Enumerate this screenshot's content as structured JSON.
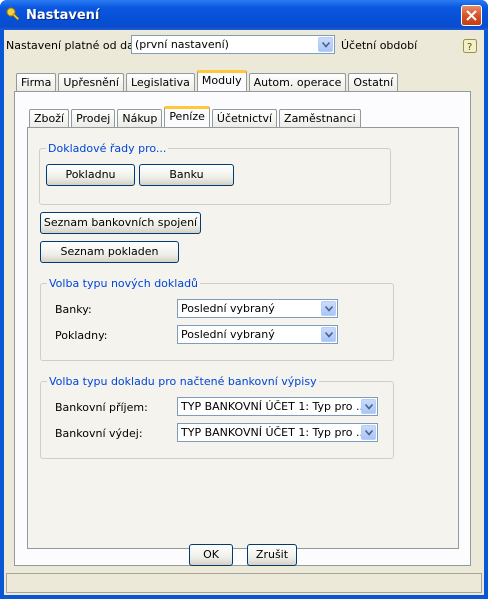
{
  "window": {
    "title": "Nastavení"
  },
  "top_row": {
    "label": "Nastavení platné od data:",
    "combo_value": "(první nastavení)",
    "period_label": "Účetní období"
  },
  "main_tabs": [
    {
      "label": "Firma",
      "active": false
    },
    {
      "label": "Upřesnění",
      "active": false
    },
    {
      "label": "Legislativa",
      "active": false
    },
    {
      "label": "Moduly",
      "active": true
    },
    {
      "label": "Autom. operace",
      "active": false
    },
    {
      "label": "Ostatní",
      "active": false
    }
  ],
  "sub_tabs": [
    {
      "label": "Zboží",
      "active": false
    },
    {
      "label": "Prodej",
      "active": false
    },
    {
      "label": "Nákup",
      "active": false
    },
    {
      "label": "Peníze",
      "active": true
    },
    {
      "label": "Účetnictví",
      "active": false
    },
    {
      "label": "Zaměstnanci",
      "active": false
    }
  ],
  "doc_series": {
    "title": "Dokladové řady pro...",
    "cash_button": "Pokladnu",
    "bank_button": "Banku"
  },
  "bank_list_button": "Seznam bankovních spojení",
  "cash_list_button": "Seznam pokladen",
  "new_doc_type": {
    "title": "Volba typu nových dokladů",
    "banks_label": "Banky:",
    "banks_value": "Poslední vybraný",
    "cash_label": "Pokladny:",
    "cash_value": "Poslední vybraný"
  },
  "statement_doc_type": {
    "title": "Volba typu dokladu pro načtené bankovní výpisy",
    "income_label": "Bankovní příjem:",
    "income_value": "TYP BANKOVNÍ ÚČET 1: Typ pro ...",
    "expense_label": "Bankovní výdej:",
    "expense_value": "TYP BANKOVNÍ ÚČET 1: Typ pro ..."
  },
  "footer": {
    "ok": "OK",
    "cancel": "Zrušit"
  },
  "colors": {
    "titlebar": "#0a58e0",
    "group_title": "#0046d5",
    "active_tab_accent": "#ffc83c",
    "face": "#ece9d8"
  }
}
